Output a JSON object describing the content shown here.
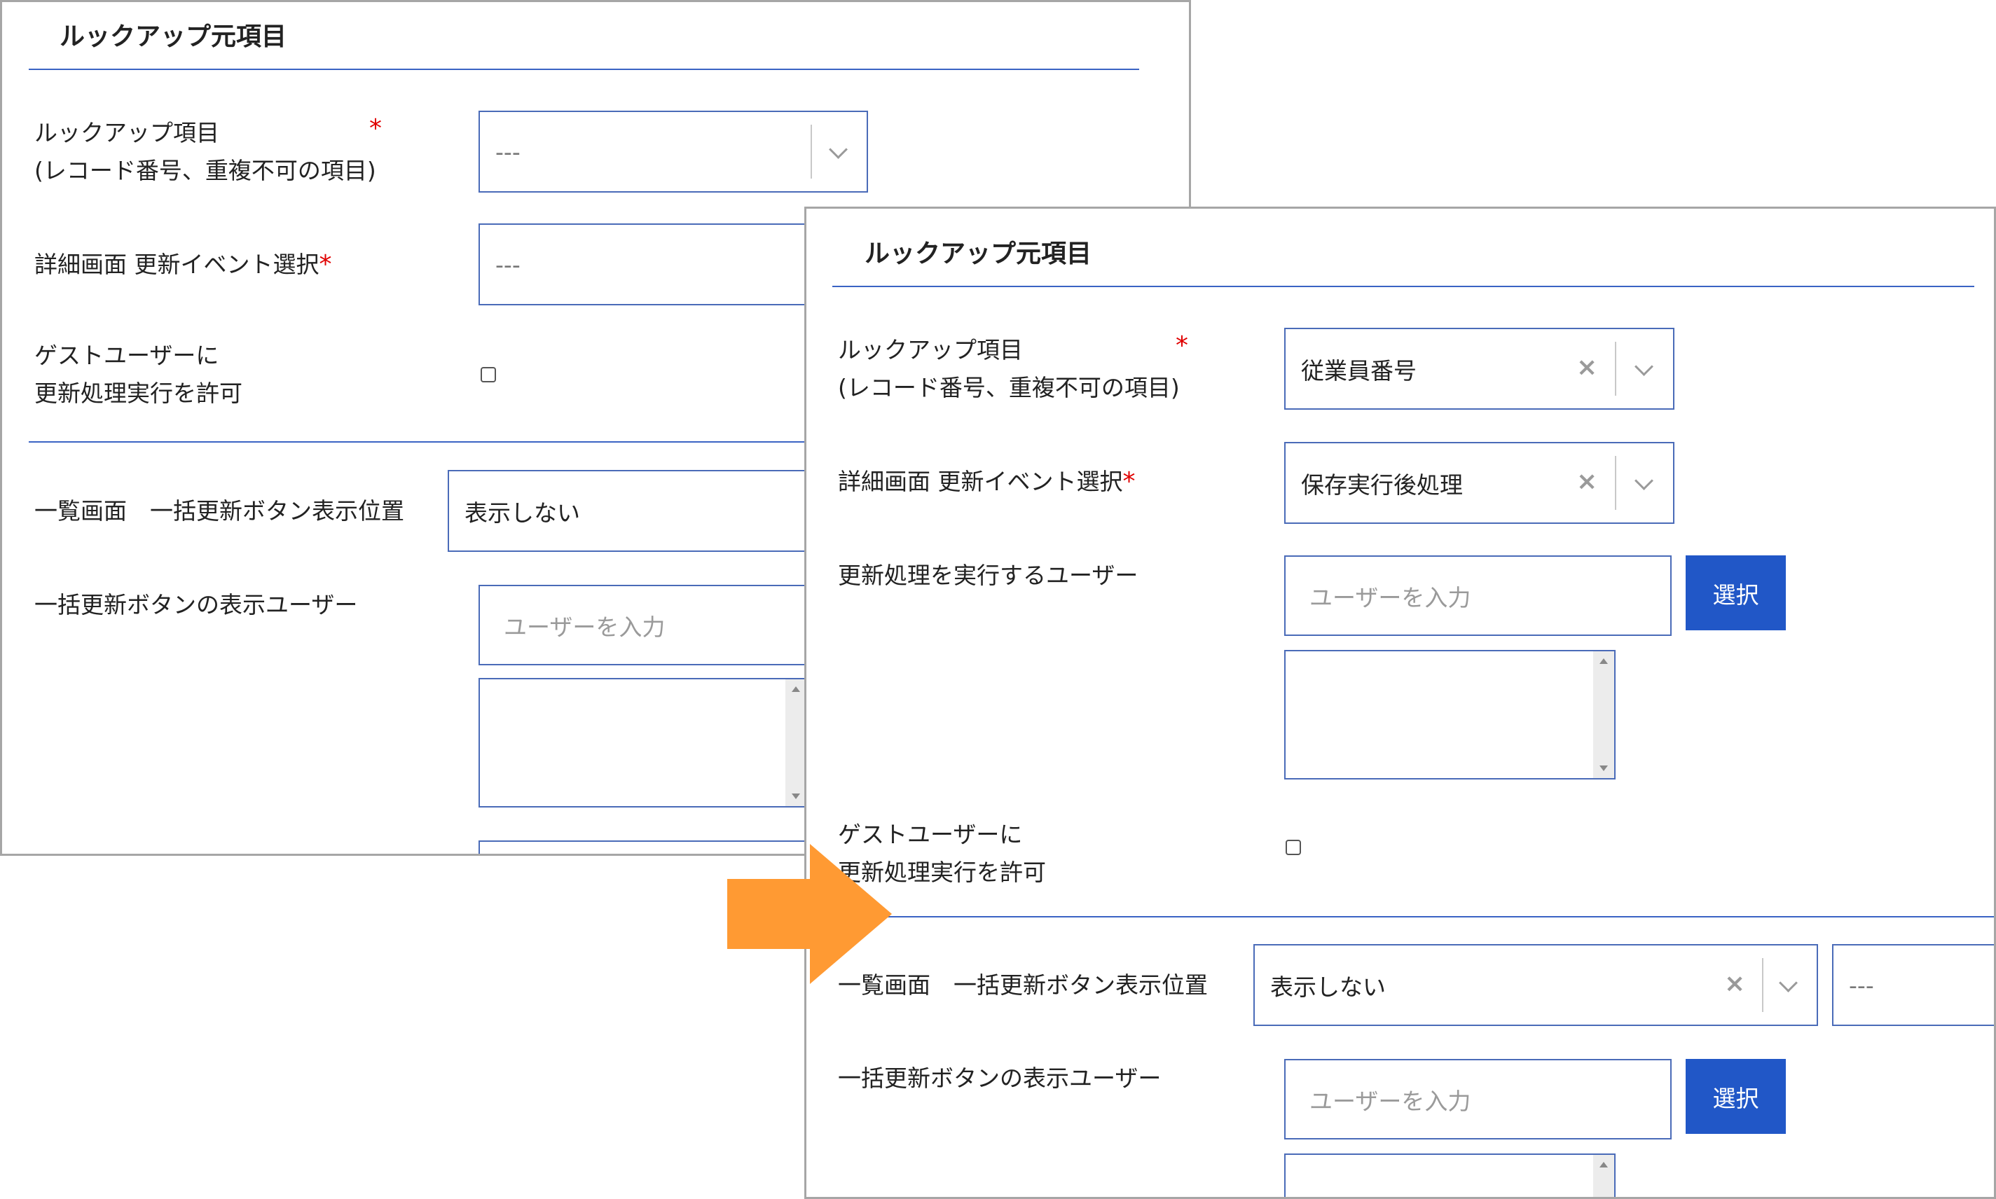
{
  "before": {
    "section_title": "ルックアップ元項目",
    "lookup_field": {
      "label_line1": "ルックアップ項目",
      "label_line2": "(レコード番号、重複不可の項目)",
      "required_mark": "*",
      "value": "---"
    },
    "detail_event": {
      "label": "詳細画面 更新イベント選択",
      "required_mark": "*",
      "value": "---"
    },
    "guest_permit": {
      "label_line1": "ゲストユーザーに",
      "label_line2": "更新処理実行を許可"
    },
    "bulk_position": {
      "label": "一覧画面　一括更新ボタン表示位置",
      "value": "表示しない"
    },
    "bulk_users": {
      "label": "一括更新ボタンの表示ユーザー",
      "placeholder": "ユーザーを入力"
    }
  },
  "after": {
    "section_title": "ルックアップ元項目",
    "lookup_field": {
      "label_line1": "ルックアップ項目",
      "label_line2": "(レコード番号、重複不可の項目)",
      "required_mark": "*",
      "value": "従業員番号"
    },
    "detail_event": {
      "label": "詳細画面 更新イベント選択",
      "required_mark": "*",
      "value": "保存実行後処理"
    },
    "exec_users": {
      "label": "更新処理を実行するユーザー",
      "placeholder": "ユーザーを入力",
      "button_label": "選択"
    },
    "guest_permit": {
      "label_line1": "ゲストユーザーに",
      "label_line2": "更新処理実行を許可"
    },
    "bulk_position": {
      "label": "一覧画面　一括更新ボタン表示位置",
      "value": "表示しない",
      "second_value": "---"
    },
    "bulk_users": {
      "label": "一括更新ボタンの表示ユーザー",
      "placeholder": "ユーザーを入力",
      "button_label": "選択"
    }
  },
  "colors": {
    "accent_blue": "#2157c7",
    "rule_blue": "#3a63c4",
    "required_red": "#e00000",
    "arrow_orange": "#ff9a33"
  }
}
